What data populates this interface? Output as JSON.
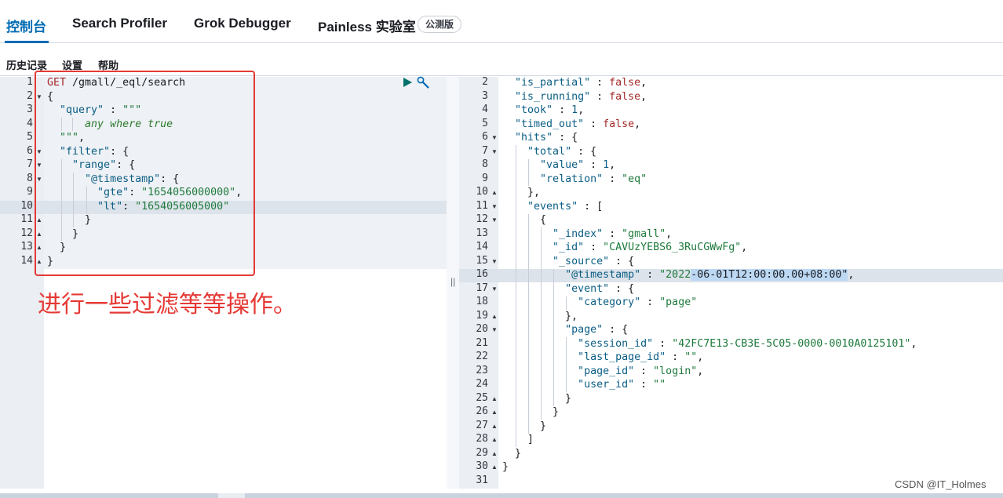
{
  "tabs": [
    {
      "label": "控制台",
      "active": true
    },
    {
      "label": "Search Profiler"
    },
    {
      "label": "Grok Debugger"
    },
    {
      "label": "Painless 实验室"
    }
  ],
  "beta_badge": "公测版",
  "submenu": [
    "历史记录",
    "设置",
    "帮助"
  ],
  "request_lines": [
    [
      [
        "m",
        "GET "
      ],
      [
        "p",
        "/gmall/_eql/search"
      ]
    ],
    [
      [
        "p",
        "{"
      ]
    ],
    [
      [
        "p",
        "  "
      ],
      [
        "k",
        "\"query\""
      ],
      [
        "p",
        " : "
      ],
      [
        "s",
        "\"\"\""
      ]
    ],
    [
      [
        "p",
        "      "
      ],
      [
        "it",
        "any where true"
      ]
    ],
    [
      [
        "p",
        "  "
      ],
      [
        "s",
        "\"\"\""
      ],
      [
        "p",
        ","
      ]
    ],
    [
      [
        "p",
        "  "
      ],
      [
        "k",
        "\"filter\""
      ],
      [
        "p",
        ": {"
      ]
    ],
    [
      [
        "p",
        "    "
      ],
      [
        "k",
        "\"range\""
      ],
      [
        "p",
        ": {"
      ]
    ],
    [
      [
        "p",
        "      "
      ],
      [
        "k",
        "\"@timestamp\""
      ],
      [
        "p",
        ": {"
      ]
    ],
    [
      [
        "p",
        "        "
      ],
      [
        "k",
        "\"gte\""
      ],
      [
        "p",
        ": "
      ],
      [
        "s",
        "\"1654056000000\""
      ],
      [
        "p",
        ","
      ]
    ],
    [
      [
        "p",
        "        "
      ],
      [
        "k",
        "\"lt\""
      ],
      [
        "p",
        ": "
      ],
      [
        "s",
        "\"1654056005000\""
      ]
    ],
    [
      [
        "p",
        "      }"
      ]
    ],
    [
      [
        "p",
        "    }"
      ]
    ],
    [
      [
        "p",
        "  }"
      ]
    ],
    [
      [
        "p",
        "}"
      ]
    ]
  ],
  "request_line_numbers": [
    "1",
    "2",
    "3",
    "4",
    "5",
    "6",
    "7",
    "8",
    "9",
    "10",
    "11",
    "12",
    "13",
    "14"
  ],
  "response_line_numbers": [
    "2",
    "3",
    "4",
    "5",
    "6",
    "7",
    "8",
    "9",
    "10",
    "11",
    "12",
    "13",
    "14",
    "15",
    "16",
    "17",
    "18",
    "19",
    "20",
    "21",
    "22",
    "23",
    "24",
    "25",
    "26",
    "27",
    "28",
    "29",
    "30",
    "31"
  ],
  "response_lines": [
    [
      [
        "p",
        "  "
      ],
      [
        "k",
        "\"is_partial\""
      ],
      [
        "p",
        " : "
      ],
      [
        "m",
        "false"
      ],
      [
        "p",
        ","
      ]
    ],
    [
      [
        "p",
        "  "
      ],
      [
        "k",
        "\"is_running\""
      ],
      [
        "p",
        " : "
      ],
      [
        "m",
        "false"
      ],
      [
        "p",
        ","
      ]
    ],
    [
      [
        "p",
        "  "
      ],
      [
        "k",
        "\"took\""
      ],
      [
        "p",
        " : "
      ],
      [
        "n",
        "1"
      ],
      [
        "p",
        ","
      ]
    ],
    [
      [
        "p",
        "  "
      ],
      [
        "k",
        "\"timed_out\""
      ],
      [
        "p",
        " : "
      ],
      [
        "m",
        "false"
      ],
      [
        "p",
        ","
      ]
    ],
    [
      [
        "p",
        "  "
      ],
      [
        "k",
        "\"hits\""
      ],
      [
        "p",
        " : {"
      ]
    ],
    [
      [
        "p",
        "    "
      ],
      [
        "k",
        "\"total\""
      ],
      [
        "p",
        " : {"
      ]
    ],
    [
      [
        "p",
        "      "
      ],
      [
        "k",
        "\"value\""
      ],
      [
        "p",
        " : "
      ],
      [
        "n",
        "1"
      ],
      [
        "p",
        ","
      ]
    ],
    [
      [
        "p",
        "      "
      ],
      [
        "k",
        "\"relation\""
      ],
      [
        "p",
        " : "
      ],
      [
        "s",
        "\"eq\""
      ]
    ],
    [
      [
        "p",
        "    },"
      ]
    ],
    [
      [
        "p",
        "    "
      ],
      [
        "k",
        "\"events\""
      ],
      [
        "p",
        " : ["
      ]
    ],
    [
      [
        "p",
        "      {"
      ]
    ],
    [
      [
        "p",
        "        "
      ],
      [
        "k",
        "\"_index\""
      ],
      [
        "p",
        " : "
      ],
      [
        "s",
        "\"gmall\""
      ],
      [
        "p",
        ","
      ]
    ],
    [
      [
        "p",
        "        "
      ],
      [
        "k",
        "\"_id\""
      ],
      [
        "p",
        " : "
      ],
      [
        "s",
        "\"CAVUzYEBS6_3RuCGWwFg\""
      ],
      [
        "p",
        ","
      ]
    ],
    [
      [
        "p",
        "        "
      ],
      [
        "k",
        "\"_source\""
      ],
      [
        "p",
        " : {"
      ]
    ],
    [
      [
        "p",
        "          "
      ],
      [
        "k",
        "\"@timestamp\""
      ],
      [
        "p",
        " : "
      ],
      [
        "s",
        "\"2022"
      ],
      [
        "sel",
        "-06-01T12:00:00.00+08:00\""
      ],
      [
        "p",
        ","
      ]
    ],
    [
      [
        "p",
        "          "
      ],
      [
        "k",
        "\"event\""
      ],
      [
        "p",
        " : {"
      ]
    ],
    [
      [
        "p",
        "            "
      ],
      [
        "k",
        "\"category\""
      ],
      [
        "p",
        " : "
      ],
      [
        "s",
        "\"page\""
      ]
    ],
    [
      [
        "p",
        "          },"
      ]
    ],
    [
      [
        "p",
        "          "
      ],
      [
        "k",
        "\"page\""
      ],
      [
        "p",
        " : {"
      ]
    ],
    [
      [
        "p",
        "            "
      ],
      [
        "k",
        "\"session_id\""
      ],
      [
        "p",
        " : "
      ],
      [
        "s",
        "\"42FC7E13-CB3E-5C05-0000-0010A0125101\""
      ],
      [
        "p",
        ","
      ]
    ],
    [
      [
        "p",
        "            "
      ],
      [
        "k",
        "\"last_page_id\""
      ],
      [
        "p",
        " : "
      ],
      [
        "s",
        "\"\""
      ],
      [
        "p",
        ","
      ]
    ],
    [
      [
        "p",
        "            "
      ],
      [
        "k",
        "\"page_id\""
      ],
      [
        "p",
        " : "
      ],
      [
        "s",
        "\"login\""
      ],
      [
        "p",
        ","
      ]
    ],
    [
      [
        "p",
        "            "
      ],
      [
        "k",
        "\"user_id\""
      ],
      [
        "p",
        " : "
      ],
      [
        "s",
        "\"\""
      ]
    ],
    [
      [
        "p",
        "          }"
      ]
    ],
    [
      [
        "p",
        "        }"
      ]
    ],
    [
      [
        "p",
        "      }"
      ]
    ],
    [
      [
        "p",
        "    ]"
      ]
    ],
    [
      [
        "p",
        "  }"
      ]
    ],
    [
      [
        "p",
        "}"
      ]
    ],
    [
      [
        "p",
        ""
      ]
    ]
  ],
  "annotation": "进行一些过滤等等操作。",
  "watermark": "CSDN @IT_Holmes",
  "icons": {
    "run": "play-icon",
    "settings": "wrench-icon"
  }
}
